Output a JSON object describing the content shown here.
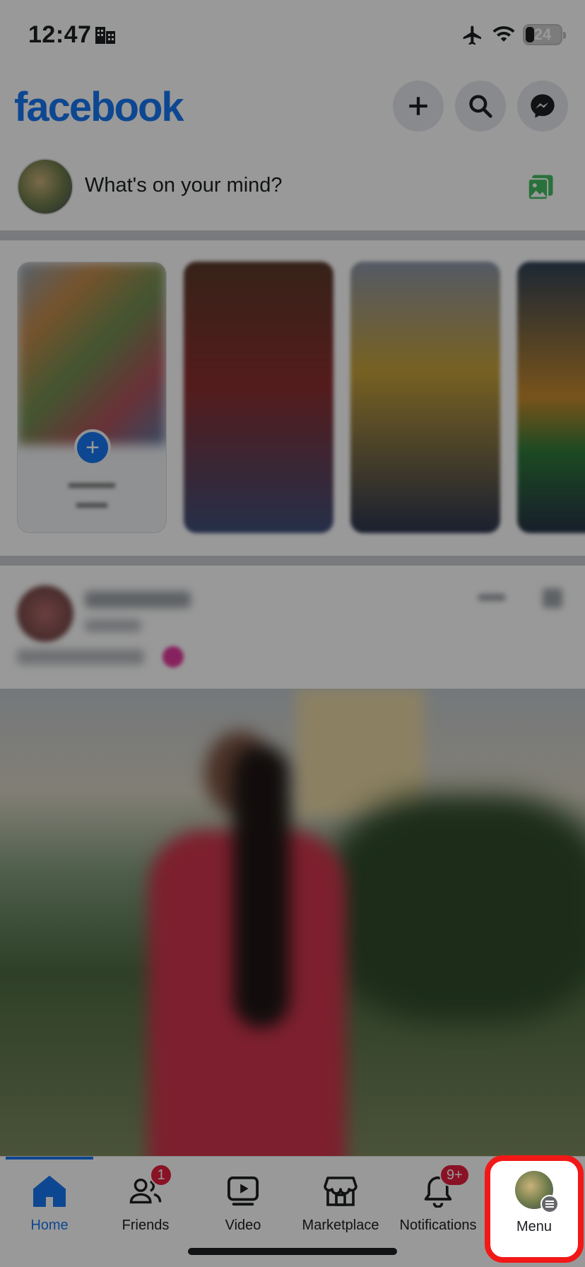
{
  "status_bar": {
    "time": "12:47",
    "battery": "24"
  },
  "header": {
    "logo": "facebook",
    "buttons": [
      "plus-icon",
      "search-icon",
      "messenger-icon"
    ]
  },
  "composer": {
    "placeholder": "What's on your mind?"
  },
  "tabs": [
    {
      "label": "Home",
      "icon": "home-icon",
      "active": true
    },
    {
      "label": "Friends",
      "icon": "friends-icon",
      "badge": "1"
    },
    {
      "label": "Video",
      "icon": "video-icon"
    },
    {
      "label": "Marketplace",
      "icon": "marketplace-icon"
    },
    {
      "label": "Notifications",
      "icon": "bell-icon",
      "badge": "9+"
    },
    {
      "label": "Menu",
      "icon": "profile-avatar",
      "highlighted": true
    }
  ],
  "colors": {
    "brand": "#1877f2",
    "badge": "#e41e3f",
    "highlight": "#f21818"
  }
}
